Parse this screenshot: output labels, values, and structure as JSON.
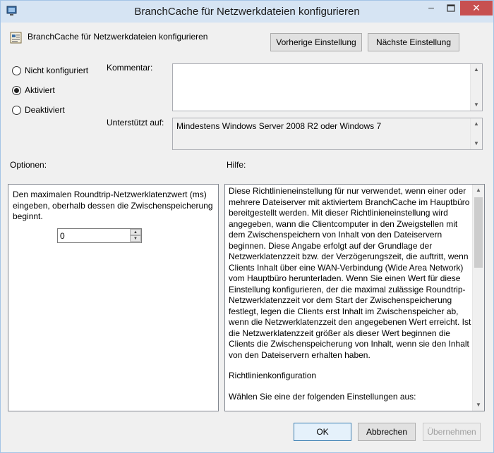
{
  "window": {
    "title": "BranchCache für Netzwerkdateien konfigurieren",
    "minimize_glyph": "–",
    "close_glyph": "✕",
    "accent": "#c75050"
  },
  "header": {
    "policy_name": "BranchCache für Netzwerkdateien konfigurieren",
    "prev_button": "Vorherige Einstellung",
    "next_button": "Nächste Einstellung"
  },
  "state": {
    "options": [
      {
        "label": "Nicht konfiguriert",
        "checked": false
      },
      {
        "label": "Aktiviert",
        "checked": true
      },
      {
        "label": "Deaktiviert",
        "checked": false
      }
    ]
  },
  "comment": {
    "label": "Kommentar:",
    "value": ""
  },
  "supported": {
    "label": "Unterstützt auf:",
    "value": "Mindestens Windows Server 2008 R2 oder Windows 7"
  },
  "options_section": {
    "label": "Optionen:",
    "description": "Den maximalen Roundtrip-Netzwerklatenzwert (ms) eingeben, oberhalb dessen die Zwischenspeicherung beginnt.",
    "spin_value": "0"
  },
  "help_section": {
    "label": "Hilfe:",
    "paragraphs": [
      "Diese Richtlinieneinstellung für nur verwendet, wenn einer oder mehrere Dateiserver mit aktiviertem BranchCache im Hauptbüro bereitgestellt werden. Mit dieser Richtlinieneinstellung wird angegeben, wann die Clientcomputer in den Zweigstellen mit dem Zwischenspeichern von Inhalt von den Dateiservern beginnen. Diese Angabe erfolgt auf der Grundlage der Netzwerklatenzzeit bzw. der Verzögerungszeit, die auftritt, wenn Clients Inhalt über eine WAN-Verbindung (Wide Area Network) vom Hauptbüro herunterladen.  Wenn Sie einen Wert für diese Einstellung konfigurieren, der die maximal zulässige Roundtrip-Netzwerklatenzzeit vor dem Start der Zwischenspeicherung festlegt, legen die Clients erst Inhalt im Zwischenspeicher ab, wenn die Netzwerklatenzzeit den angegebenen Wert erreicht. Ist die Netzwerklatenzzeit größer als dieser Wert beginnen die Clients die Zwischenspeicherung von Inhalt, wenn sie den Inhalt von den Dateiservern erhalten haben.",
      "Richtlinienkonfiguration",
      "Wählen Sie eine der folgenden Einstellungen aus:"
    ]
  },
  "footer": {
    "ok": "OK",
    "cancel": "Abbrechen",
    "apply": "Übernehmen"
  }
}
